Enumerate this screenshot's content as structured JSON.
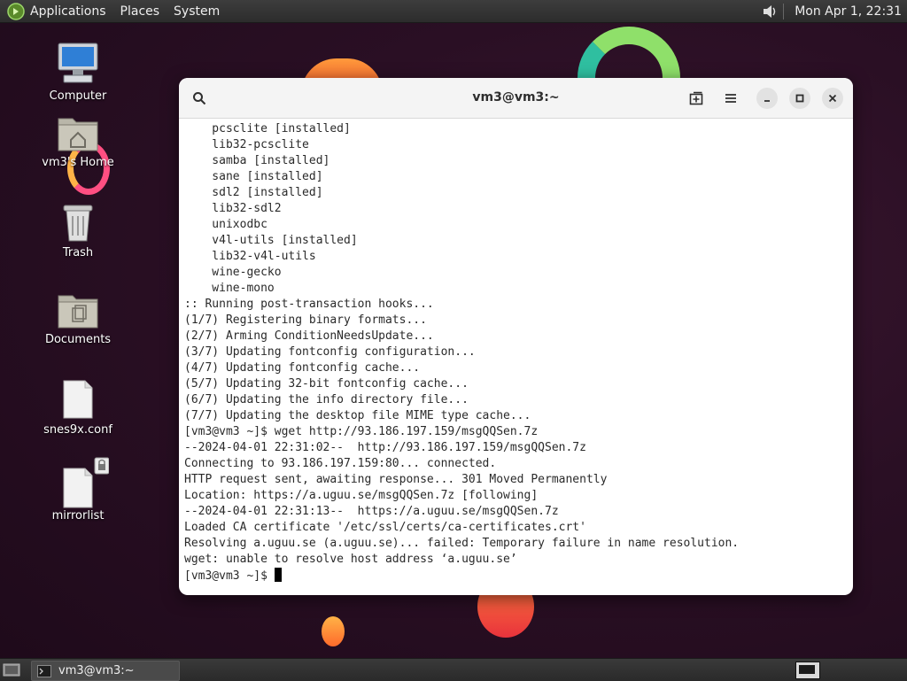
{
  "top_panel": {
    "menus": [
      {
        "label": "Applications",
        "icon": "mate-logo-icon"
      },
      {
        "label": "Places"
      },
      {
        "label": "System"
      }
    ],
    "volume_icon": "speaker-icon",
    "clock": "Mon Apr  1, 22:31"
  },
  "desktop": {
    "icons": [
      {
        "label": "Computer",
        "icon": "computer-icon"
      },
      {
        "label": "vm3's Home",
        "icon": "home-folder-icon"
      },
      {
        "label": "Trash",
        "icon": "trash-icon"
      },
      {
        "label": "Documents",
        "icon": "documents-folder-icon"
      },
      {
        "label": "snes9x.conf",
        "icon": "file-icon"
      },
      {
        "label": "mirrorlist",
        "icon": "locked-file-icon"
      }
    ]
  },
  "terminal": {
    "title": "vm3@vm3:~",
    "lines": [
      "    pcsclite [installed]",
      "    lib32-pcsclite",
      "    samba [installed]",
      "    sane [installed]",
      "    sdl2 [installed]",
      "    lib32-sdl2",
      "    unixodbc",
      "    v4l-utils [installed]",
      "    lib32-v4l-utils",
      "    wine-gecko",
      "    wine-mono",
      ":: Running post-transaction hooks...",
      "(1/7) Registering binary formats...",
      "(2/7) Arming ConditionNeedsUpdate...",
      "(3/7) Updating fontconfig configuration...",
      "(4/7) Updating fontconfig cache...",
      "(5/7) Updating 32-bit fontconfig cache...",
      "(6/7) Updating the info directory file...",
      "(7/7) Updating the desktop file MIME type cache...",
      "[vm3@vm3 ~]$ wget http://93.186.197.159/msgQQSen.7z",
      "--2024-04-01 22:31:02--  http://93.186.197.159/msgQQSen.7z",
      "Connecting to 93.186.197.159:80... connected.",
      "HTTP request sent, awaiting response... 301 Moved Permanently",
      "Location: https://a.uguu.se/msgQQSen.7z [following]",
      "--2024-04-01 22:31:13--  https://a.uguu.se/msgQQSen.7z",
      "Loaded CA certificate '/etc/ssl/certs/ca-certificates.crt'",
      "Resolving a.uguu.se (a.uguu.se)... failed: Temporary failure in name resolution.",
      "wget: unable to resolve host address ‘a.uguu.se’"
    ],
    "prompt": "[vm3@vm3 ~]$ "
  },
  "bottom_panel": {
    "task_label": "vm3@vm3:~"
  }
}
